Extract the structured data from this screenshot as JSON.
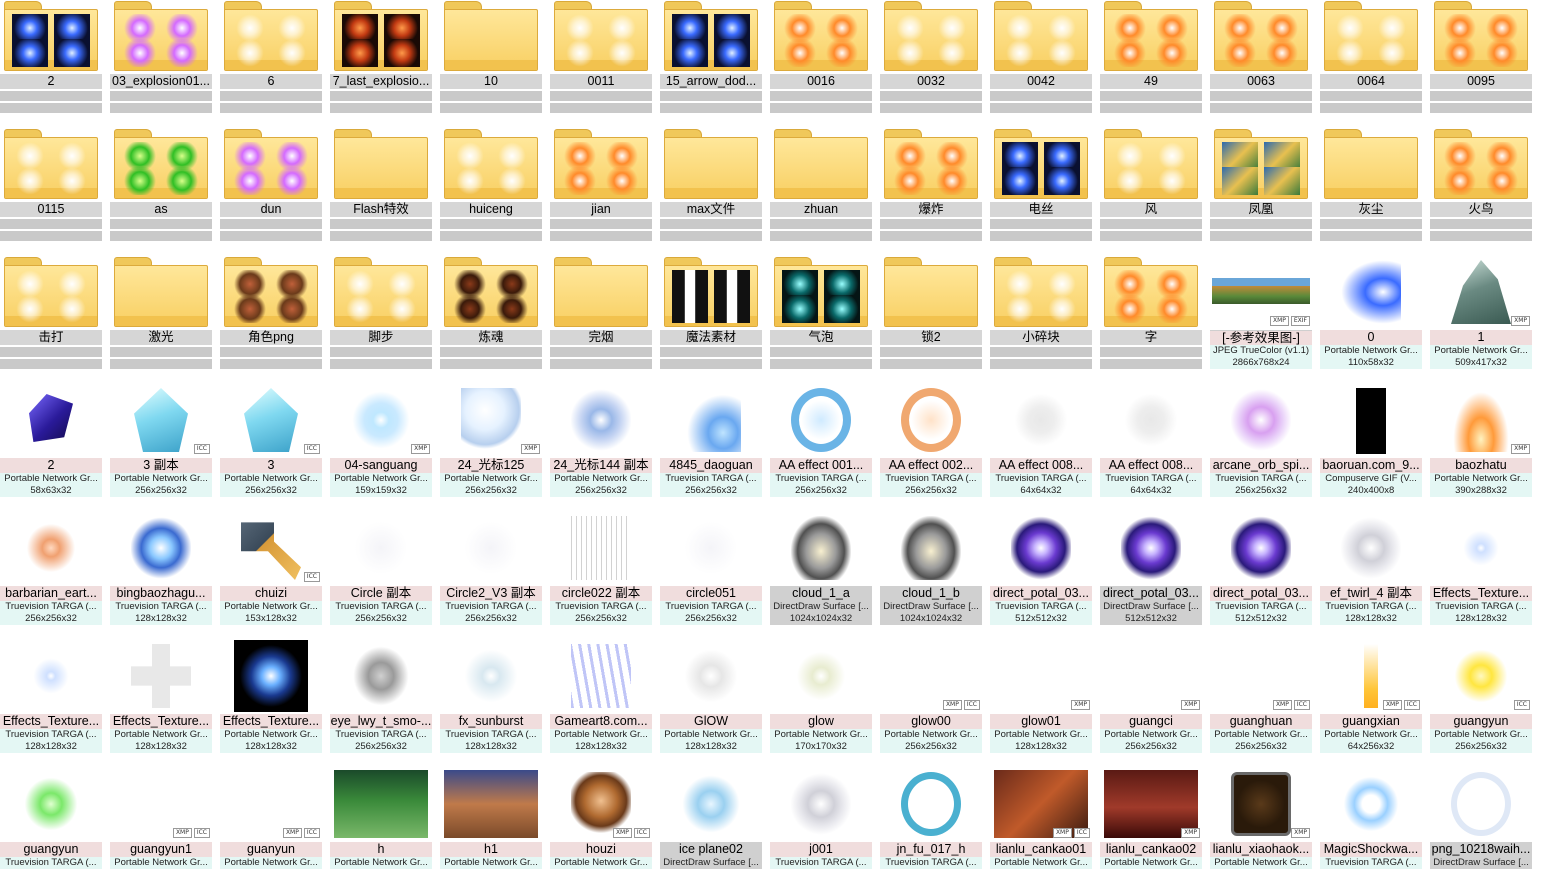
{
  "badges": {
    "xmp": "XMP",
    "icc": "ICC",
    "exif": "EXIF"
  },
  "folders": [
    {
      "name": "2",
      "pv": "glowB"
    },
    {
      "name": "03_explosion01...",
      "pv": "glowP"
    },
    {
      "name": "6",
      "pv": "glowW"
    },
    {
      "name": "7_last_explosio...",
      "pv": "glowR"
    },
    {
      "name": "10",
      "pv": "none"
    },
    {
      "name": "0011",
      "pv": "glowW"
    },
    {
      "name": "15_arrow_dod...",
      "pv": "glowB"
    },
    {
      "name": "0016",
      "pv": "glowO"
    },
    {
      "name": "0032",
      "pv": "glowW"
    },
    {
      "name": "0042",
      "pv": "glowW"
    },
    {
      "name": "49",
      "pv": "glowO"
    },
    {
      "name": "0063",
      "pv": "glowO"
    },
    {
      "name": "0064",
      "pv": "glowW"
    },
    {
      "name": "0095",
      "pv": "glowO"
    },
    {
      "name": "0115",
      "pv": "glowW"
    },
    {
      "name": "as",
      "pv": "glowG"
    },
    {
      "name": "dun",
      "pv": "glowP"
    },
    {
      "name": "Flash特效",
      "pv": "none"
    },
    {
      "name": "huiceng",
      "pv": "glowW"
    },
    {
      "name": "jian",
      "pv": "glowO"
    },
    {
      "name": "max文件",
      "pv": "none"
    },
    {
      "name": "zhuan",
      "pv": "none"
    },
    {
      "name": "爆炸",
      "pv": "glowO"
    },
    {
      "name": "电丝",
      "pv": "glowB"
    },
    {
      "name": "风",
      "pv": "glowW"
    },
    {
      "name": "凤凰",
      "pv": "scene"
    },
    {
      "name": "灰尘",
      "pv": "none"
    },
    {
      "name": "火鸟",
      "pv": "glowO"
    },
    {
      "name": "击打",
      "pv": "glowW"
    },
    {
      "name": "激光",
      "pv": "none"
    },
    {
      "name": "角色png",
      "pv": "char"
    },
    {
      "name": "脚步",
      "pv": "glowW"
    },
    {
      "name": "炼魂",
      "pv": "orb"
    },
    {
      "name": "完烟",
      "pv": "none"
    },
    {
      "name": "魔法素材",
      "pv": "bar"
    },
    {
      "name": "气泡",
      "pv": "teal"
    },
    {
      "name": "锁2",
      "pv": "none"
    },
    {
      "name": "小碎块",
      "pv": "glowW"
    },
    {
      "name": "字",
      "pv": "glowO"
    }
  ],
  "images": [
    {
      "name": "[-参考效果图-]",
      "type": "JPEG TrueColor (v1.1)",
      "size": "2866x768x24",
      "badges": [
        "xmp",
        "exif"
      ],
      "art": "scene",
      "sel": true
    },
    {
      "name": "0",
      "type": "Portable Network Gr...",
      "size": "110x58x32",
      "badges": [],
      "art": "blue-streak"
    },
    {
      "name": "1",
      "type": "Portable Network Gr...",
      "size": "509x417x32",
      "badges": [
        "xmp"
      ],
      "art": "rock"
    },
    {
      "name": "2",
      "type": "Portable Network Gr...",
      "size": "58x63x32",
      "badges": [],
      "art": "gem"
    },
    {
      "name": "3 副本",
      "type": "Portable Network Gr...",
      "size": "256x256x32",
      "badges": [
        "icc"
      ],
      "art": "ice"
    },
    {
      "name": "3",
      "type": "Portable Network Gr...",
      "size": "256x256x32",
      "badges": [
        "icc"
      ],
      "art": "ice"
    },
    {
      "name": "04-sanguang",
      "type": "Portable Network Gr...",
      "size": "159x159x32",
      "badges": [
        "xmp"
      ],
      "art": "flare"
    },
    {
      "name": "24_光标125",
      "type": "Portable Network Gr...",
      "size": "256x256x32",
      "badges": [
        "xmp"
      ],
      "art": "bubble"
    },
    {
      "name": "24_光标144 副本",
      "type": "Portable Network Gr...",
      "size": "256x256x32",
      "badges": [],
      "art": "swirl-b"
    },
    {
      "name": "4845_daoguan",
      "type": "Truevision TARGA (...",
      "size": "256x256x32",
      "badges": [],
      "art": "slash"
    },
    {
      "name": "AA    effect 001...",
      "type": "Truevision TARGA (...",
      "size": "256x256x32",
      "badges": [],
      "art": "ring-b"
    },
    {
      "name": "AA    effect 002...",
      "type": "Truevision TARGA (...",
      "size": "256x256x32",
      "badges": [],
      "art": "ring-o"
    },
    {
      "name": "AA    effect 008...",
      "type": "Truevision TARGA (...",
      "size": "64x64x32",
      "badges": [],
      "art": "rune"
    },
    {
      "name": "AA    effect 008...",
      "type": "Truevision TARGA (...",
      "size": "64x64x32",
      "badges": [],
      "art": "rune"
    },
    {
      "name": "arcane_orb_spi...",
      "type": "Truevision TARGA (...",
      "size": "256x256x32",
      "badges": [],
      "art": "swirl-p"
    },
    {
      "name": "baoruan.com_9...",
      "type": "Compuserve GIF (V...",
      "size": "240x400x8",
      "badges": [],
      "art": "black"
    },
    {
      "name": "baozhatu",
      "type": "Portable Network Gr...",
      "size": "390x288x32",
      "badges": [
        "xmp"
      ],
      "art": "blast"
    },
    {
      "name": "barbarian_eart...",
      "type": "Truevision TARGA (...",
      "size": "256x256x32",
      "badges": [],
      "art": "crack"
    },
    {
      "name": "bingbaozhagu...",
      "type": "Truevision TARGA (...",
      "size": "128x128x32",
      "badges": [],
      "art": "burst-b"
    },
    {
      "name": "chuizi",
      "type": "Portable Network Gr...",
      "size": "153x128x32",
      "badges": [
        "icc"
      ],
      "art": "hammer"
    },
    {
      "name": "Circle 副本",
      "type": "Truevision TARGA (...",
      "size": "256x256x32",
      "badges": [],
      "art": "faint"
    },
    {
      "name": "Circle2_V3 副本",
      "type": "Truevision TARGA (...",
      "size": "256x256x32",
      "badges": [],
      "art": "faint"
    },
    {
      "name": "circle022 副本",
      "type": "Truevision TARGA (...",
      "size": "256x256x32",
      "badges": [],
      "art": "lines"
    },
    {
      "name": "circle051",
      "type": "Truevision TARGA (...",
      "size": "256x256x32",
      "badges": [],
      "art": "faint"
    },
    {
      "name": "cloud_1_a",
      "type": "DirectDraw Surface [...",
      "size": "1024x1024x32",
      "badges": [],
      "art": "cloud",
      "dd": true
    },
    {
      "name": "cloud_1_b",
      "type": "DirectDraw Surface [...",
      "size": "1024x1024x32",
      "badges": [],
      "art": "cloud",
      "dd": true
    },
    {
      "name": "direct_potal_03...",
      "type": "Truevision TARGA (...",
      "size": "512x512x32",
      "badges": [],
      "art": "portal"
    },
    {
      "name": "direct_potal_03...",
      "type": "DirectDraw Surface [...",
      "size": "512x512x32",
      "badges": [],
      "art": "portal",
      "dd": true
    },
    {
      "name": "direct_potal_03...",
      "type": "Truevision TARGA (...",
      "size": "512x512x32",
      "badges": [],
      "art": "portal"
    },
    {
      "name": "ef_twirl_4 副本",
      "type": "Truevision TARGA (...",
      "size": "128x128x32",
      "badges": [],
      "art": "swirl-w"
    },
    {
      "name": "Effects_Texture...",
      "type": "Truevision TARGA (...",
      "size": "128x128x32",
      "badges": [],
      "art": "star"
    },
    {
      "name": "Effects_Texture...",
      "type": "Truevision TARGA (...",
      "size": "128x128x32",
      "badges": [],
      "art": "star"
    },
    {
      "name": "Effects_Texture...",
      "type": "Portable Network Gr...",
      "size": "128x128x32",
      "badges": [],
      "art": "cross"
    },
    {
      "name": "Effects_Texture...",
      "type": "Portable Network Gr...",
      "size": "128x128x32",
      "badges": [],
      "art": "burst-dark"
    },
    {
      "name": "eye_lwy_t_smo-...",
      "type": "Truevision TARGA (...",
      "size": "256x256x32",
      "badges": [],
      "art": "smoke"
    },
    {
      "name": "fx_sunburst",
      "type": "Truevision TARGA (...",
      "size": "128x128x32",
      "badges": [],
      "art": "sunburst"
    },
    {
      "name": "Gameart8.com...",
      "type": "Portable Network Gr...",
      "size": "128x128x32",
      "badges": [],
      "art": "streaks"
    },
    {
      "name": "GlOW",
      "type": "Portable Network Gr...",
      "size": "128x128x32",
      "badges": [],
      "art": "glow-soft"
    },
    {
      "name": "glow",
      "type": "Portable Network Gr...",
      "size": "170x170x32",
      "badges": [],
      "art": "sparkle"
    },
    {
      "name": "glow00",
      "type": "Portable Network Gr...",
      "size": "256x256x32",
      "badges": [
        "xmp",
        "icc"
      ],
      "art": "none"
    },
    {
      "name": "glow01",
      "type": "Portable Network Gr...",
      "size": "128x128x32",
      "badges": [
        "xmp"
      ],
      "art": "none"
    },
    {
      "name": "guangci",
      "type": "Portable Network Gr...",
      "size": "256x256x32",
      "badges": [
        "xmp"
      ],
      "art": "none"
    },
    {
      "name": "guanghuan",
      "type": "Portable Network Gr...",
      "size": "256x256x32",
      "badges": [
        "xmp",
        "icc"
      ],
      "art": "none"
    },
    {
      "name": "guangxian",
      "type": "Portable Network Gr...",
      "size": "64x256x32",
      "badges": [
        "xmp",
        "icc"
      ],
      "art": "beam"
    },
    {
      "name": "guangyun",
      "type": "Portable Network Gr...",
      "size": "256x256x32",
      "badges": [
        "icc"
      ],
      "art": "sun"
    },
    {
      "name": "guangyun",
      "type": "Truevision TARGA (...",
      "size": "",
      "badges": [],
      "art": "green-orb"
    },
    {
      "name": "guangyun1",
      "type": "Portable Network Gr...",
      "size": "",
      "badges": [
        "xmp",
        "icc"
      ],
      "art": "none"
    },
    {
      "name": "guanyun",
      "type": "Portable Network Gr...",
      "size": "",
      "badges": [
        "xmp",
        "icc"
      ],
      "art": "none"
    },
    {
      "name": "h",
      "type": "Portable Network Gr...",
      "size": "",
      "badges": [],
      "art": "forest"
    },
    {
      "name": "h1",
      "type": "Portable Network Gr...",
      "size": "",
      "badges": [],
      "art": "town"
    },
    {
      "name": "houzi",
      "type": "Portable Network Gr...",
      "size": "",
      "badges": [
        "xmp",
        "icc"
      ],
      "art": "monkey"
    },
    {
      "name": "ice plane02",
      "type": "DirectDraw Surface [...",
      "size": "",
      "badges": [],
      "art": "ice-splash",
      "dd": true
    },
    {
      "name": "j001",
      "type": "Truevision TARGA (...",
      "size": "",
      "badges": [],
      "art": "swirl-w"
    },
    {
      "name": "jn_fu_017_h",
      "type": "Truevision TARGA (...",
      "size": "",
      "badges": [],
      "art": "ring-t"
    },
    {
      "name": "lianlu_cankao01",
      "type": "Portable Network Gr...",
      "size": "",
      "badges": [
        "xmp",
        "icc"
      ],
      "art": "ui-grid"
    },
    {
      "name": "lianlu_cankao02",
      "type": "Portable Network Gr...",
      "size": "",
      "badges": [
        "xmp"
      ],
      "art": "ui-red"
    },
    {
      "name": "lianlu_xiaohaok...",
      "type": "Portable Network Gr...",
      "size": "",
      "badges": [
        "xmp"
      ],
      "art": "frame"
    },
    {
      "name": "MagicShockwa...",
      "type": "Truevision TARGA (...",
      "size": "",
      "badges": [],
      "art": "shock"
    },
    {
      "name": "png_10218waih...",
      "type": "DirectDraw Surface [...",
      "size": "",
      "badges": [],
      "art": "ring-w",
      "dd": true
    }
  ]
}
